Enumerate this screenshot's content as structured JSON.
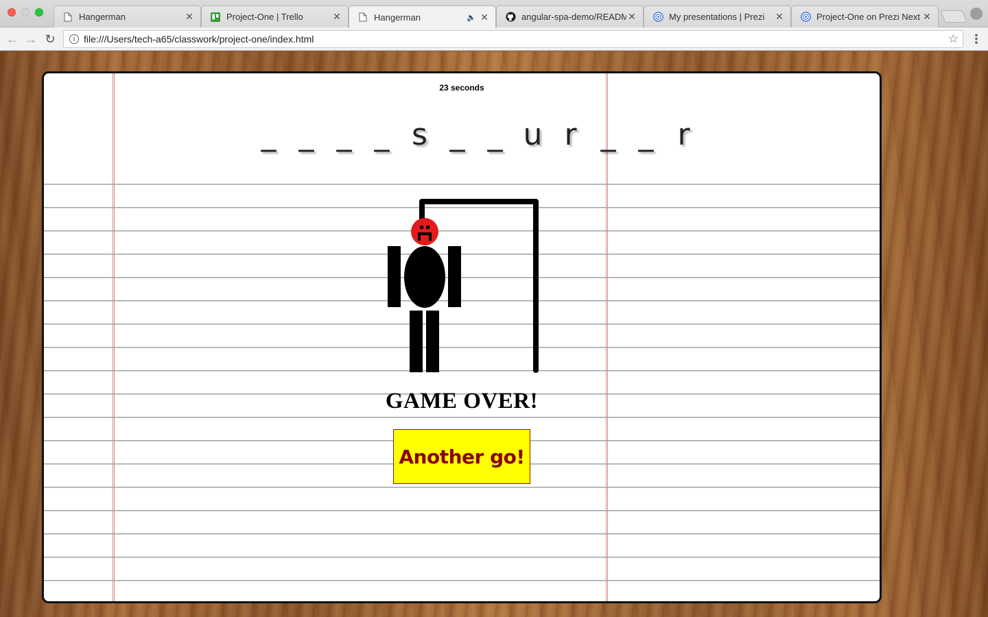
{
  "browser": {
    "tabs": [
      {
        "title": "Hangerman",
        "icon": "document-icon",
        "active": false
      },
      {
        "title": "Project-One | Trello",
        "icon": "trello-icon",
        "active": false
      },
      {
        "title": "Hangerman",
        "icon": "document-icon",
        "active": true,
        "audio": true
      },
      {
        "title": "angular-spa-demo/READM",
        "icon": "github-icon",
        "active": false
      },
      {
        "title": "My presentations | Prezi",
        "icon": "prezi-icon",
        "active": false
      },
      {
        "title": "Project-One on Prezi Next",
        "icon": "prezi-icon",
        "active": false
      }
    ],
    "url": "file:///Users/tech-a65/classwork/project-one/index.html"
  },
  "game": {
    "timer": "23 seconds",
    "word_display": [
      "_",
      "_",
      "_",
      "_",
      "s",
      "_",
      "_",
      "u",
      "r",
      "_",
      "_",
      "r"
    ],
    "result": "GAME OVER!",
    "again_button": "Another go!",
    "colors": {
      "head": "#e41b1b",
      "button_bg": "#ffff00",
      "button_text": "#8b0000",
      "paper_margin": "#d98a8a"
    }
  }
}
